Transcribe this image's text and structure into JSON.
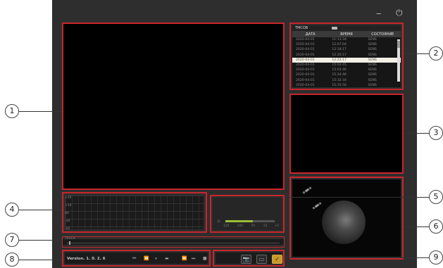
{
  "window": {
    "minimize_glyph": "‒",
    "power_glyph": "⏻"
  },
  "table": {
    "tab_label": "ТМСОВ",
    "columns": [
      "ДАТА",
      "ВРЕМЯ",
      "СОСТОЯНИЕ"
    ],
    "rows": [
      [
        "2020-04-01",
        "11:13:34",
        "SENS"
      ],
      [
        "2020-04-01",
        "12:07:04",
        "SENS"
      ],
      [
        "2020-04-01",
        "12:18:17",
        "SENS"
      ],
      [
        "2020-04-01",
        "12:20:17",
        "SENS"
      ],
      [
        "2020-04-01",
        "12:22:17",
        "SENS"
      ],
      [
        "2020-04-01",
        "15:02:45",
        "SENS"
      ],
      [
        "2020-04-01",
        "15:02:46",
        "SENS"
      ],
      [
        "2020-04-01",
        "15:24:46",
        "SENS"
      ],
      [
        "2020-04-01",
        "15:32:34",
        "SENS"
      ],
      [
        "2020-04-01",
        "15:35:50",
        "SENS"
      ]
    ],
    "selected_row": 4
  },
  "graph": {
    "y_labels": [
      "+20",
      "+10",
      "0G",
      "-10",
      "-20"
    ]
  },
  "meter": {
    "level": 0.55,
    "icon": "⚠",
    "ticks": [
      "-120",
      "-100",
      "-50",
      "-10",
      "+0"
    ]
  },
  "track": {
    "label": "TRACK",
    "position": 0.01
  },
  "controls": {
    "version": "Version. 1. 0. 2. 6",
    "buttons": [
      "⏮",
      "⏪",
      "⏸",
      "▬",
      "⏩",
      "⏭",
      "■"
    ]
  },
  "actions": {
    "camera": "📷",
    "save": "▭",
    "export": "✓"
  },
  "callouts": [
    "1",
    "2",
    "3",
    "4",
    "5",
    "6",
    "7",
    "8",
    "9"
  ],
  "colors": {
    "frame": "#c8262c",
    "selected_row": "#f2efe4",
    "accent": "#c79a2b",
    "meter_fill": "#9bbf3a"
  }
}
